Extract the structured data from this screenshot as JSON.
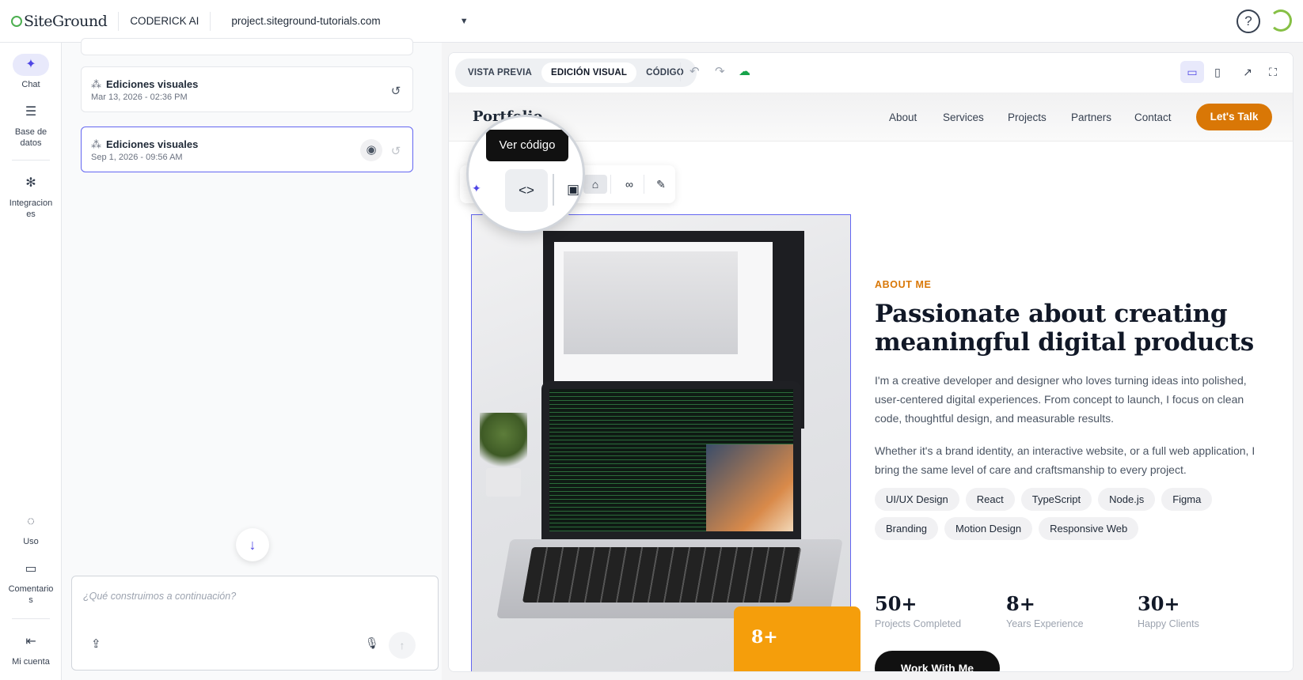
{
  "topbar": {
    "brand": "SiteGround",
    "app_name": "CODERICK AI",
    "project": "project.siteground-tutorials.com",
    "help_label": "?"
  },
  "nav": {
    "chat": "Chat",
    "database": [
      "Base de",
      "datos"
    ],
    "integrations": [
      "Integracion",
      "es"
    ],
    "usage": "Uso",
    "comments": [
      "Comentario",
      "s"
    ],
    "account": "Mi cuenta"
  },
  "history": [
    {
      "title": "Ediciones visuales",
      "date": "Mar 13, 2026 - 02:36 PM"
    },
    {
      "title": "Ediciones visuales",
      "date": "Sep 1, 2026 - 09:56 AM"
    }
  ],
  "composer": {
    "placeholder": "¿Qué construimos a continuación?"
  },
  "preview": {
    "tabs": [
      "VISTA PREVIA",
      "EDICIÓN VISUAL",
      "CÓDIGO"
    ],
    "active_tab": "EDICIÓN VISUAL"
  },
  "tooltip": "Ver código",
  "site": {
    "brand": "Portfolio",
    "nav": [
      "About",
      "Services",
      "Projects",
      "Partners",
      "Contact"
    ],
    "cta": "Let's Talk",
    "eyebrow": "ABOUT ME",
    "headline": "Passionate about creating meaningful digital products",
    "para1": "I'm a creative developer and designer who loves turning ideas into polished, user-centered digital experiences. From concept to launch, I focus on clean code, thoughtful design, and measurable results.",
    "para2": "Whether it's a brand identity, an interactive website, or a full web application, I bring the same level of care and craftsmanship to every project.",
    "skills": [
      "UI/UX Design",
      "React",
      "TypeScript",
      "Node.js",
      "Figma",
      "Branding",
      "Motion Design",
      "Responsive Web"
    ],
    "stats": [
      {
        "num": "50+",
        "label": "Projects Completed"
      },
      {
        "num": "8+",
        "label": "Years Experience"
      },
      {
        "num": "30+",
        "label": "Happy Clients"
      }
    ],
    "badge": "8+",
    "work_button": "Work With Me"
  },
  "colors": {
    "accent": "#4f46e5",
    "orange": "#d97706",
    "badge": "#f59e0b"
  }
}
